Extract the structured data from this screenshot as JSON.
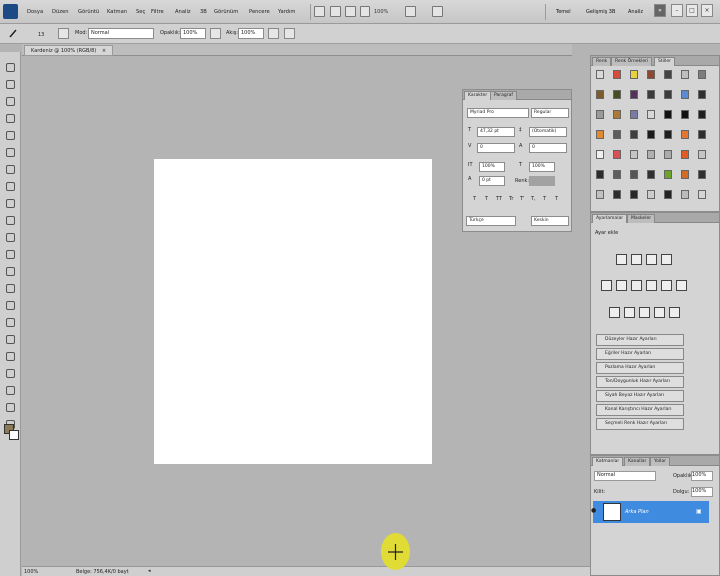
{
  "menubar": {
    "items": [
      "Dosya",
      "Düzen",
      "Görüntü",
      "Katman",
      "Seç",
      "Filtre",
      "Analiz",
      "3B",
      "Görünüm",
      "Pencere",
      "Yardım"
    ],
    "zoom_value": "100%",
    "workspaces": [
      "Temel",
      "Gelişmiş 3B",
      "Analiz"
    ],
    "more": "»"
  },
  "options": {
    "brush_size": "13",
    "mode_label": "Mod:",
    "mode_value": "Normal",
    "opacity_label": "Opaklık:",
    "opacity_value": "100%",
    "flow_label": "Akış:",
    "flow_value": "100%"
  },
  "document": {
    "tab_title": "Kardeniz @ 100% (RGB/8)",
    "close": "×"
  },
  "status": {
    "zoom": "100%",
    "info": "Belge: 756,4K/0 bayt"
  },
  "swatches": {
    "tabs": [
      "Renk",
      "Renk Örnekleri",
      "Stiller"
    ],
    "colors": [
      "#d9d9d9",
      "#d84a3c",
      "#e8d13a",
      "#8d4a2e",
      "#434343",
      "#bfbfbf",
      "#7d7d7d",
      "#7e5b2c",
      "#464e22",
      "#55305d",
      "#3c3c3c",
      "#3b3b3b",
      "#5a8bd0",
      "#303030",
      "#9a9a9a",
      "#ad7a36",
      "#787aa7",
      "#d7d7d7",
      "#111111",
      "#111111",
      "#1f1f1f",
      "#e08930",
      "#5d5d5d",
      "#3e3e3e",
      "#1b1b1b",
      "#1e1e1e",
      "#e4762f",
      "#2e2e2e",
      "#f0f0f0",
      "#d85050",
      "#c4c4c4",
      "#b0b0b0",
      "#aaaaaa",
      "#e35b22",
      "#c5c5c5",
      "#2d2d2d",
      "#5e5e5e",
      "#565656",
      "#303030",
      "#6ba32b",
      "#d26b26",
      "#2f2f2f",
      "#c0c0c0",
      "#2c2c2c",
      "#282828",
      "#cccccc",
      "#232323",
      "#bcbcbc",
      "#d5d5d5"
    ]
  },
  "character": {
    "tabs": [
      "Karakter",
      "Paragraf"
    ],
    "font_family": "Myriad Pro",
    "font_style": "Regular",
    "font_size": "47,32 pt",
    "leading": "(Otomatik)",
    "kerning": "0",
    "tracking": "0",
    "vscale": "100%",
    "hscale": "100%",
    "baseline": "0 pt",
    "color_label": "Renk:",
    "style_buttons": [
      "T",
      "T",
      "TT",
      "Tr",
      "T'",
      "T,",
      "T",
      "T"
    ],
    "language": "Türkçe",
    "aa": "Keskin"
  },
  "adjustments": {
    "tabs": [
      "Ayarlamalar",
      "Maskeler"
    ],
    "heading": "Ayar ekle",
    "presets": [
      "Düzeyler Hazır Ayarları",
      "Eğriler Hazır Ayarları",
      "Pozlama Hazır Ayarları",
      "Ton/Doygunluk Hazır Ayarları",
      "Siyah Beyaz Hazır Ayarları",
      "Kanal Karıştırıcı Hazır Ayarları",
      "Seçmeli Renk Hazır Ayarları"
    ]
  },
  "layers": {
    "tabs": [
      "Katmanlar",
      "Kanallar",
      "Yollar"
    ],
    "blend_mode": "Normal",
    "opacity_label": "Opaklık:",
    "opacity_value": "100%",
    "lock_label": "Kilit:",
    "fill_label": "Dolgu:",
    "fill_value": "100%",
    "layer_name": "Arka Plan"
  }
}
